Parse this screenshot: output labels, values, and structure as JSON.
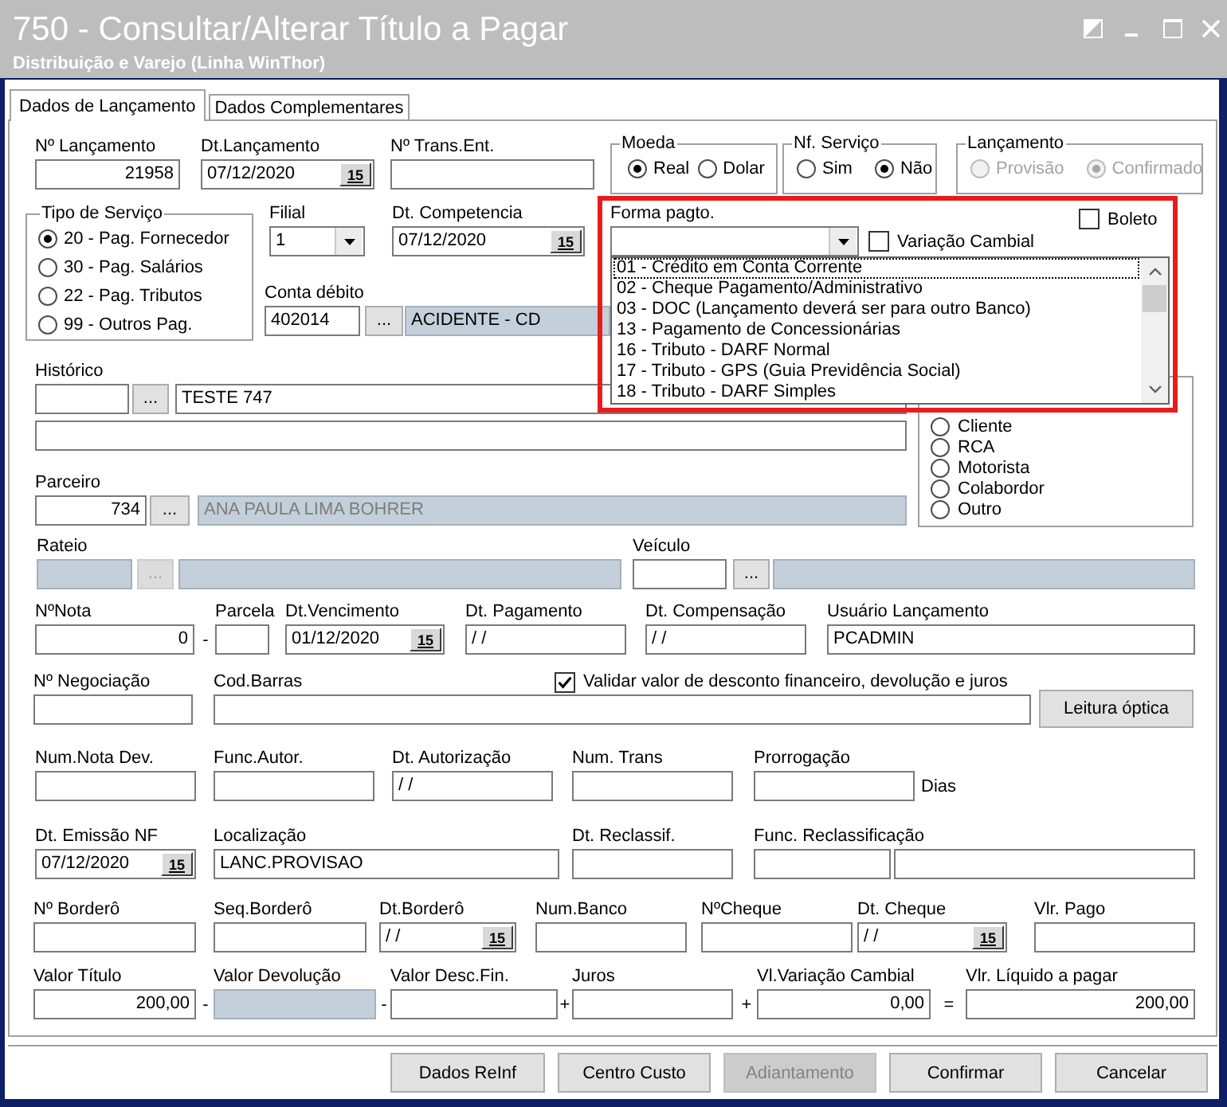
{
  "window": {
    "title": "750 - Consultar/Alterar Título a Pagar",
    "subtitle": "Distribuição e Varejo (Linha WinThor)"
  },
  "tabs": [
    {
      "label": "Dados de Lançamento",
      "selected": true
    },
    {
      "label": "Dados Complementares",
      "selected": false
    }
  ],
  "row_1": {
    "fields": [
      {
        "label": "Nº Lançamento",
        "parts": [
          {
            "kind": "number",
            "value": "21958"
          }
        ]
      },
      {
        "label": "Dt.Lançamento",
        "parts": [
          {
            "kind": "date",
            "value": "07/12/2020",
            "button": "15"
          }
        ]
      },
      {
        "label": "Nº Trans.Ent.",
        "parts": [
          {
            "kind": "input"
          }
        ]
      }
    ],
    "groups": [
      {
        "title": "Moeda",
        "disabled": false,
        "options": [
          {
            "label": "Real",
            "selected": true
          },
          {
            "label": "Dolar",
            "selected": false
          }
        ]
      },
      {
        "title": "Nf. Serviço",
        "disabled": false,
        "options": [
          {
            "label": "Sim",
            "selected": false
          },
          {
            "label": "Não",
            "selected": true
          }
        ]
      },
      {
        "title": "Lançamento",
        "disabled": true,
        "options": [
          {
            "label": "Provisão",
            "selected": false
          },
          {
            "label": "Confirmado",
            "selected": true
          }
        ]
      }
    ]
  },
  "tipo_servico": {
    "title": "Tipo de Serviço",
    "options": [
      {
        "label": "20 - Pag. Fornecedor",
        "selected": true
      },
      {
        "label": "30 - Pag. Salários",
        "selected": false
      },
      {
        "label": "22 - Pag. Tributos",
        "selected": false
      },
      {
        "label": "99 - Outros Pag.",
        "selected": false
      }
    ]
  },
  "row_2": {
    "fields": [
      {
        "label": "Filial",
        "parts": [
          {
            "kind": "combo",
            "value": "1",
            "expanded": false
          }
        ]
      },
      {
        "label": "Dt. Competencia",
        "parts": [
          {
            "kind": "date",
            "value": "07/12/2020",
            "button": "15"
          }
        ]
      },
      {
        "label": "Forma pagto.",
        "parts": [
          {
            "kind": "combo",
            "expanded": true,
            "options": [
              {
                "label": "01 - Crédito em Conta Corrente",
                "focused": true
              },
              {
                "label": "02 - Cheque Pagamento/Administrativo",
                "focused": false
              },
              {
                "label": "03 - DOC (Lançamento deverá ser para outro Banco)",
                "focused": false
              },
              {
                "label": "13 - Pagamento de Concessionárias",
                "focused": false
              },
              {
                "label": "16 - Tributo - DARF Normal",
                "focused": false
              },
              {
                "label": "17 - Tributo - GPS (Guia Previdência Social)",
                "focused": false
              },
              {
                "label": "18 - Tributo - DARF Simples",
                "focused": false
              }
            ]
          }
        ]
      }
    ],
    "checkboxes": [
      {
        "label": "Variação Cambial",
        "checked": false
      },
      {
        "label": "Boleto",
        "checked": false
      }
    ]
  },
  "conta_debito": {
    "label": "Conta débito",
    "parts": [
      {
        "kind": "input",
        "value": "402014"
      },
      {
        "kind": "button",
        "label": "..."
      },
      {
        "kind": "input",
        "value": "ACIDENTE - CD",
        "readonly": true
      }
    ]
  },
  "historico": {
    "label": "Histórico",
    "parts": [
      {
        "kind": "input"
      },
      {
        "kind": "button",
        "label": "..."
      },
      {
        "kind": "input",
        "value": "TESTE 747"
      }
    ],
    "second_line": {
      "parts": [
        {
          "kind": "input"
        }
      ]
    }
  },
  "parceiro": {
    "label": "Parceiro",
    "parts": [
      {
        "kind": "number",
        "value": "734"
      },
      {
        "kind": "button",
        "label": "..."
      },
      {
        "kind": "input",
        "value": "ANA PAULA LIMA BOHRER",
        "disabled": true
      }
    ]
  },
  "tipo_parceiro": {
    "options": [
      {
        "label": "Cliente",
        "selected": false
      },
      {
        "label": "RCA",
        "selected": false
      },
      {
        "label": "Motorista",
        "selected": false
      },
      {
        "label": "Colabordor",
        "selected": false
      },
      {
        "label": "Outro",
        "selected": false
      }
    ]
  },
  "rows": [
    [
      {
        "label": "Rateio",
        "parts": [
          {
            "kind": "input",
            "disabled": true
          },
          {
            "kind": "button",
            "label": "...",
            "disabled": true
          },
          {
            "kind": "input",
            "disabled": true
          }
        ]
      },
      {
        "label": "Veículo",
        "parts": [
          {
            "kind": "input"
          },
          {
            "kind": "button",
            "label": "..."
          },
          {
            "kind": "input",
            "readonly": true
          }
        ]
      }
    ],
    [
      {
        "label": "NºNota",
        "parts": [
          {
            "kind": "number",
            "value": "0"
          },
          {
            "kind": "operator",
            "text": "-"
          }
        ]
      },
      {
        "label": "Parcela",
        "parts": [
          {
            "kind": "input"
          }
        ]
      },
      {
        "label": "Dt.Vencimento",
        "parts": [
          {
            "kind": "date",
            "value": "01/12/2020",
            "button": "15"
          }
        ]
      },
      {
        "label": "Dt. Pagamento",
        "parts": [
          {
            "kind": "input",
            "value": "/ /"
          }
        ]
      },
      {
        "label": "Dt. Compensação",
        "parts": [
          {
            "kind": "input",
            "value": "/ /"
          }
        ]
      },
      {
        "label": "Usuário Lançamento",
        "parts": [
          {
            "kind": "input",
            "value": "PCADMIN"
          }
        ]
      }
    ],
    [
      {
        "label": "Nº Negociação",
        "parts": [
          {
            "kind": "input"
          }
        ]
      },
      {
        "label": "Cod.Barras",
        "checkbox": {
          "label": "Validar valor de desconto financeiro, devolução e juros",
          "checked": true
        },
        "parts": [
          {
            "kind": "input"
          }
        ]
      },
      {
        "parts": [
          {
            "kind": "action",
            "label": "Leitura óptica"
          }
        ]
      }
    ],
    [
      {
        "label": "Num.Nota Dev.",
        "parts": [
          {
            "kind": "input"
          }
        ]
      },
      {
        "label": "Func.Autor.",
        "parts": [
          {
            "kind": "input"
          }
        ]
      },
      {
        "label": "Dt. Autorização",
        "parts": [
          {
            "kind": "input",
            "value": "/ /"
          }
        ]
      },
      {
        "label": "Num. Trans",
        "parts": [
          {
            "kind": "input"
          }
        ]
      },
      {
        "label": "Prorrogação",
        "parts": [
          {
            "kind": "input"
          },
          {
            "kind": "unit",
            "text": "Dias"
          }
        ]
      }
    ],
    [
      {
        "label": "Dt. Emissão NF",
        "parts": [
          {
            "kind": "date",
            "value": "07/12/2020",
            "button": "15"
          }
        ]
      },
      {
        "label": "Localização",
        "parts": [
          {
            "kind": "input",
            "value": "LANC.PROVISAO"
          }
        ]
      },
      {
        "label": "Dt. Reclassif.",
        "parts": [
          {
            "kind": "input"
          }
        ]
      },
      {
        "label": "Func. Reclassificação",
        "parts": [
          {
            "kind": "input"
          },
          {
            "kind": "input"
          }
        ]
      }
    ],
    [
      {
        "label": "Nº Borderô",
        "parts": [
          {
            "kind": "input"
          }
        ]
      },
      {
        "label": "Seq.Borderô",
        "parts": [
          {
            "kind": "input"
          }
        ]
      },
      {
        "label": "Dt.Borderô",
        "parts": [
          {
            "kind": "date",
            "value": "/ /",
            "button": "15"
          }
        ]
      },
      {
        "label": "Num.Banco",
        "parts": [
          {
            "kind": "input"
          }
        ]
      },
      {
        "label": "NºCheque",
        "parts": [
          {
            "kind": "input"
          }
        ]
      },
      {
        "label": "Dt. Cheque",
        "parts": [
          {
            "kind": "date",
            "value": "/ /",
            "button": "15"
          }
        ]
      },
      {
        "label": "Vlr. Pago",
        "parts": [
          {
            "kind": "input"
          }
        ]
      }
    ],
    [
      {
        "label": "Valor Título",
        "parts": [
          {
            "kind": "number",
            "value": "200,00"
          },
          {
            "kind": "operator",
            "text": "-"
          }
        ]
      },
      {
        "label": "Valor Devolução",
        "parts": [
          {
            "kind": "input",
            "readonly": true
          },
          {
            "kind": "operator",
            "text": "-"
          }
        ]
      },
      {
        "label": "Valor Desc.Fin.",
        "parts": [
          {
            "kind": "input"
          },
          {
            "kind": "operator",
            "text": "+"
          }
        ]
      },
      {
        "label": "Juros",
        "parts": [
          {
            "kind": "input"
          },
          {
            "kind": "operator",
            "text": "+"
          }
        ]
      },
      {
        "label": "Vl.Variação Cambial",
        "parts": [
          {
            "kind": "number",
            "value": "0,00"
          },
          {
            "kind": "operator",
            "text": "="
          }
        ]
      },
      {
        "label": "Vlr. Líquido a pagar",
        "parts": [
          {
            "kind": "number",
            "value": "200,00"
          }
        ]
      }
    ]
  ],
  "buttons": [
    {
      "label": "Dados ReInf",
      "disabled": false
    },
    {
      "label": "Centro Custo",
      "disabled": false
    },
    {
      "label": "Adiantamento",
      "disabled": true
    },
    {
      "label": "Confirmar",
      "disabled": false
    },
    {
      "label": "Cancelar",
      "disabled": false
    }
  ]
}
